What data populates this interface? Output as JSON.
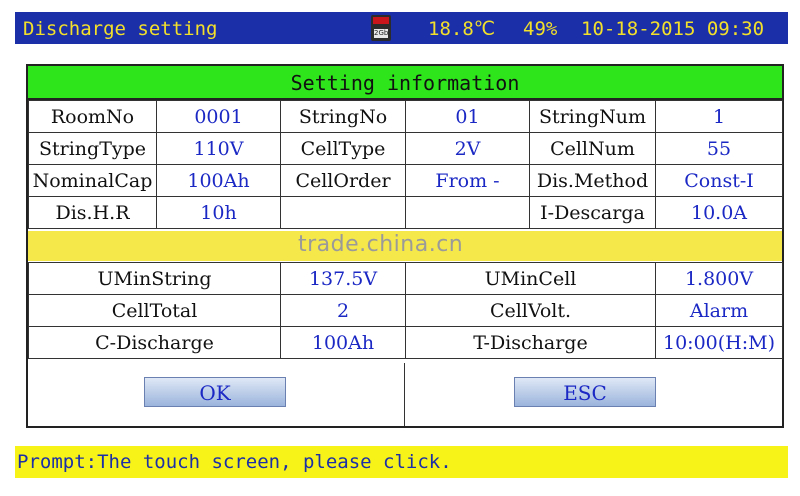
{
  "topbar": {
    "title": "Discharge setting",
    "sd_card_label": "2Gb",
    "temperature": "18.8℃",
    "battery": "49%",
    "datetime": "10-18-2015 09:30"
  },
  "setting_info": {
    "header": "Setting information",
    "rows": [
      [
        "RoomNo",
        "0001",
        "StringNo",
        "01",
        "StringNum",
        "1"
      ],
      [
        "StringType",
        "110V",
        "CellType",
        "2V",
        "CellNum",
        "55"
      ],
      [
        "NominalCap",
        "100Ah",
        "CellOrder",
        "From -",
        "Dis.Method",
        "Const-I"
      ],
      [
        "Dis.H.R",
        "10h",
        "",
        "",
        "I-Descarga",
        "10.0A"
      ]
    ]
  },
  "limits": {
    "rows": [
      [
        "UMinString",
        "137.5V",
        "UMinCell",
        "1.800V"
      ],
      [
        "CellTotal",
        "2",
        "CellVolt.",
        "Alarm"
      ],
      [
        "C-Discharge",
        "100Ah",
        "T-Discharge",
        "10:00(H:M)"
      ]
    ]
  },
  "buttons": {
    "ok": "OK",
    "esc": "ESC"
  },
  "watermark": "trade.china.cn",
  "prompt": "Prompt:The touch screen, please click.",
  "colors": {
    "title_bar": "#1b2fa8",
    "title_text": "#f3e02a",
    "header_green": "#2ee51c",
    "value_blue": "#1b28c4",
    "prompt_bg": "#f7f318"
  }
}
